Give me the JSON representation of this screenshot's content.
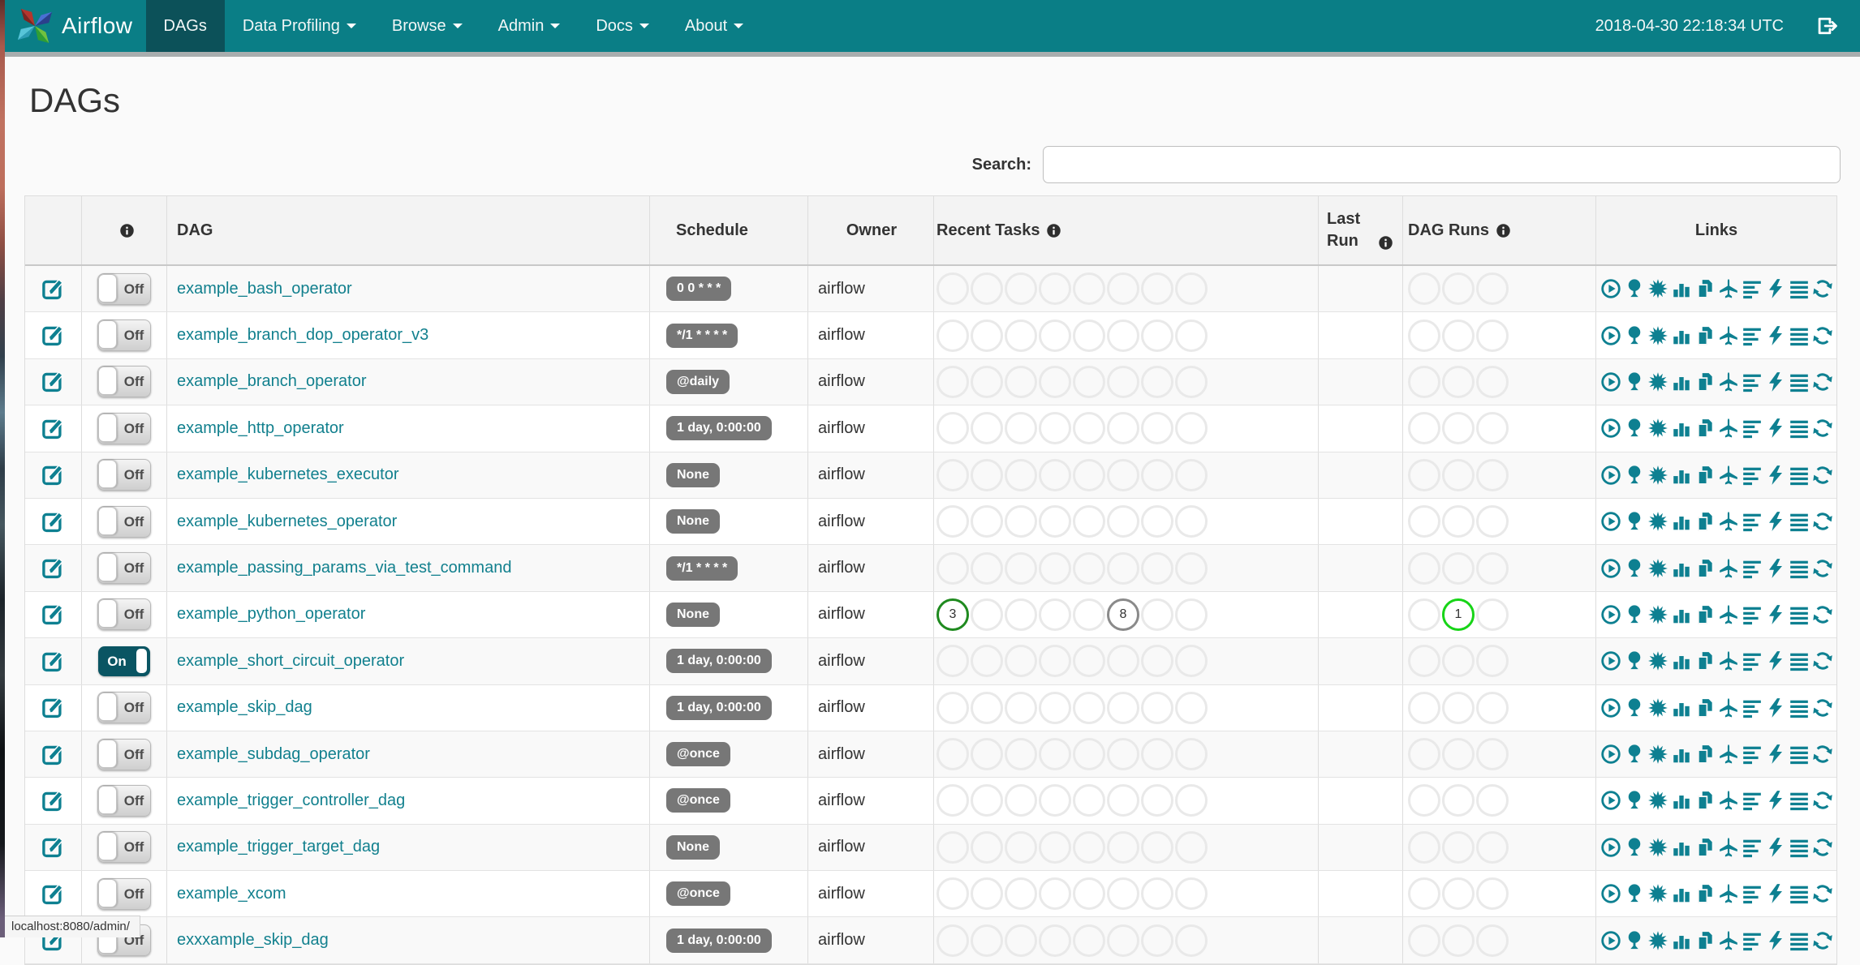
{
  "navbar": {
    "brand": "Airflow",
    "items": [
      {
        "label": "DAGs",
        "active": true,
        "caret": false
      },
      {
        "label": "Data Profiling",
        "active": false,
        "caret": true
      },
      {
        "label": "Browse",
        "active": false,
        "caret": true
      },
      {
        "label": "Admin",
        "active": false,
        "caret": true
      },
      {
        "label": "Docs",
        "active": false,
        "caret": true
      },
      {
        "label": "About",
        "active": false,
        "caret": true
      }
    ],
    "clock": "2018-04-30 22:18:34 UTC"
  },
  "page": {
    "title": "DAGs",
    "search_label": "Search:",
    "search_value": "",
    "status_bar": "localhost:8080/admin/"
  },
  "ui": {
    "toggle_on": "On",
    "toggle_off": "Off"
  },
  "colors": {
    "navbar": "#0a7e86",
    "navbar_active": "#0c5159",
    "link": "#12808e",
    "badge": "#777777",
    "toggle_on": "#0a5563",
    "circle_empty_border": "#e9e9e9",
    "states": {
      "success": "#1f8a1f",
      "none": "#8a8a8a",
      "running": "#17d417"
    }
  },
  "table": {
    "headers": {
      "edit": "",
      "info": "",
      "dag": "DAG",
      "schedule": "Schedule",
      "owner": "Owner",
      "recent_tasks": "Recent Tasks",
      "last_run": "Last Run",
      "dag_runs": "DAG Runs",
      "links": "Links"
    },
    "recent_task_slots": 8,
    "dag_run_slots": 3,
    "links": [
      {
        "name": "trigger-dag-icon"
      },
      {
        "name": "tree-view-icon"
      },
      {
        "name": "graph-view-icon"
      },
      {
        "name": "task-duration-icon"
      },
      {
        "name": "task-tries-icon"
      },
      {
        "name": "landing-times-icon"
      },
      {
        "name": "gantt-view-icon"
      },
      {
        "name": "code-view-icon"
      },
      {
        "name": "logs-icon"
      },
      {
        "name": "refresh-icon"
      }
    ],
    "rows": [
      {
        "name": "example_bash_operator",
        "schedule": "0 0 * * *",
        "owner": "airflow",
        "enabled": false,
        "recent_tasks": [],
        "dag_runs": []
      },
      {
        "name": "example_branch_dop_operator_v3",
        "schedule": "*/1 * * * *",
        "owner": "airflow",
        "enabled": false,
        "recent_tasks": [],
        "dag_runs": []
      },
      {
        "name": "example_branch_operator",
        "schedule": "@daily",
        "owner": "airflow",
        "enabled": false,
        "recent_tasks": [],
        "dag_runs": []
      },
      {
        "name": "example_http_operator",
        "schedule": "1 day, 0:00:00",
        "owner": "airflow",
        "enabled": false,
        "recent_tasks": [],
        "dag_runs": []
      },
      {
        "name": "example_kubernetes_executor",
        "schedule": "None",
        "owner": "airflow",
        "enabled": false,
        "recent_tasks": [],
        "dag_runs": []
      },
      {
        "name": "example_kubernetes_operator",
        "schedule": "None",
        "owner": "airflow",
        "enabled": false,
        "recent_tasks": [],
        "dag_runs": []
      },
      {
        "name": "example_passing_params_via_test_command",
        "schedule": "*/1 * * * *",
        "owner": "airflow",
        "enabled": false,
        "recent_tasks": [],
        "dag_runs": []
      },
      {
        "name": "example_python_operator",
        "schedule": "None",
        "owner": "airflow",
        "enabled": false,
        "recent_tasks": [
          {
            "slot": 0,
            "count": "3",
            "state": "success"
          },
          {
            "slot": 5,
            "count": "8",
            "state": "none"
          }
        ],
        "dag_runs": [
          {
            "slot": 1,
            "count": "1",
            "state": "running"
          }
        ]
      },
      {
        "name": "example_short_circuit_operator",
        "schedule": "1 day, 0:00:00",
        "owner": "airflow",
        "enabled": true,
        "recent_tasks": [],
        "dag_runs": []
      },
      {
        "name": "example_skip_dag",
        "schedule": "1 day, 0:00:00",
        "owner": "airflow",
        "enabled": false,
        "recent_tasks": [],
        "dag_runs": []
      },
      {
        "name": "example_subdag_operator",
        "schedule": "@once",
        "owner": "airflow",
        "enabled": false,
        "recent_tasks": [],
        "dag_runs": []
      },
      {
        "name": "example_trigger_controller_dag",
        "schedule": "@once",
        "owner": "airflow",
        "enabled": false,
        "recent_tasks": [],
        "dag_runs": []
      },
      {
        "name": "example_trigger_target_dag",
        "schedule": "None",
        "owner": "airflow",
        "enabled": false,
        "recent_tasks": [],
        "dag_runs": []
      },
      {
        "name": "example_xcom",
        "schedule": "@once",
        "owner": "airflow",
        "enabled": false,
        "recent_tasks": [],
        "dag_runs": []
      },
      {
        "name": "exxxample_skip_dag",
        "schedule": "1 day, 0:00:00",
        "owner": "airflow",
        "enabled": false,
        "recent_tasks": [],
        "dag_runs": []
      }
    ]
  }
}
